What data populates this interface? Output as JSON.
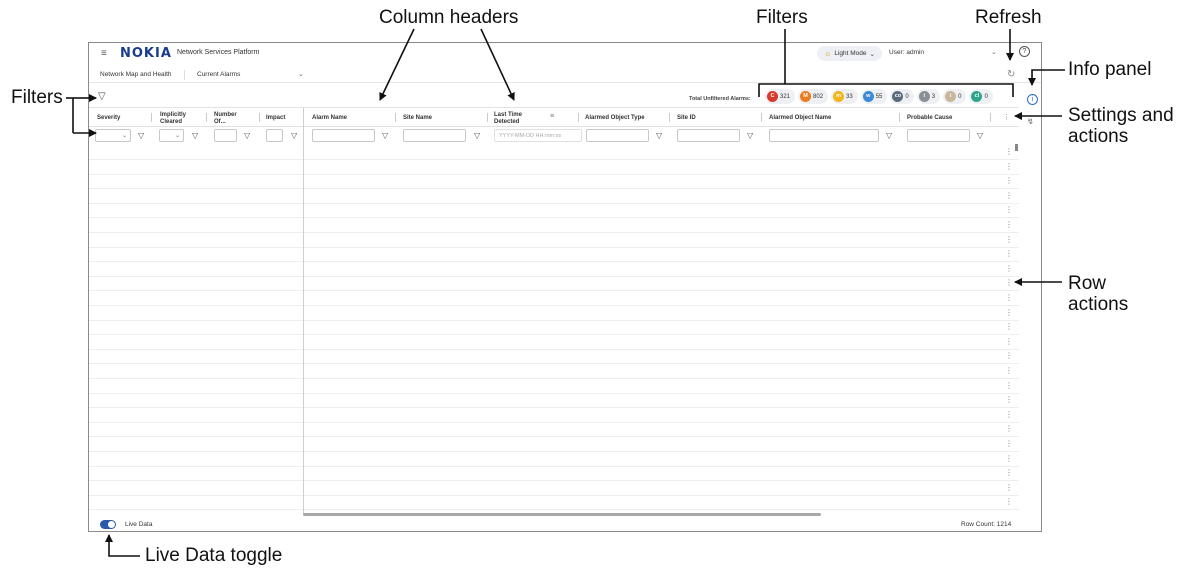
{
  "callouts": {
    "column_headers": "Column headers",
    "filters_top": "Filters",
    "refresh": "Refresh",
    "info_panel": "Info panel",
    "filters_left": "Filters",
    "settings_actions_1": "Settings and",
    "settings_actions_2": "actions",
    "row_actions_1": "Row",
    "row_actions_2": "actions",
    "live_data_toggle": "Live Data toggle"
  },
  "topbar": {
    "logo": "NOKIA",
    "app_title": "Network Services Platform",
    "light_mode": "Light Mode",
    "user": "User: admin",
    "help_icon": "?"
  },
  "nav": {
    "item1": "Network Map and Health",
    "item2": "Current Alarms"
  },
  "summary": {
    "label": "Total Unfiltered Alarms:",
    "badges": [
      {
        "letter": "C",
        "count": "321",
        "color": "#d83a2c"
      },
      {
        "letter": "M",
        "count": "802",
        "color": "#ee7b1f"
      },
      {
        "letter": "m",
        "count": "33",
        "color": "#f2b51c"
      },
      {
        "letter": "w",
        "count": "55",
        "color": "#3d8ad6"
      },
      {
        "letter": "co",
        "count": "0",
        "color": "#5b6a7d"
      },
      {
        "letter": "i",
        "count": "3",
        "color": "#8a8f96"
      },
      {
        "letter": "i",
        "count": "0",
        "color": "#c8b79a"
      },
      {
        "letter": "cl",
        "count": "0",
        "color": "#2ea58a"
      }
    ]
  },
  "columns": {
    "severity": "Severity",
    "implicitly_cleared_1": "Implicitly",
    "implicitly_cleared_2": "Cleared",
    "number_of_1": "Number",
    "number_of_2": "Of...",
    "impact": "Impact",
    "alarm_name": "Alarm Name",
    "site_name": "Site Name",
    "last_time_1": "Last Time",
    "last_time_2": "Detected",
    "alarmed_object_type": "Alarmed Object Type",
    "site_id": "Site ID",
    "alarmed_object_name": "Alarmed Object Name",
    "probable_cause": "Probable Cause"
  },
  "filters": {
    "date_placeholder": "YYYY-MM-DD HH:mm:ss"
  },
  "footer": {
    "live_data": "Live Data",
    "row_count": "Row Count: 1214"
  }
}
